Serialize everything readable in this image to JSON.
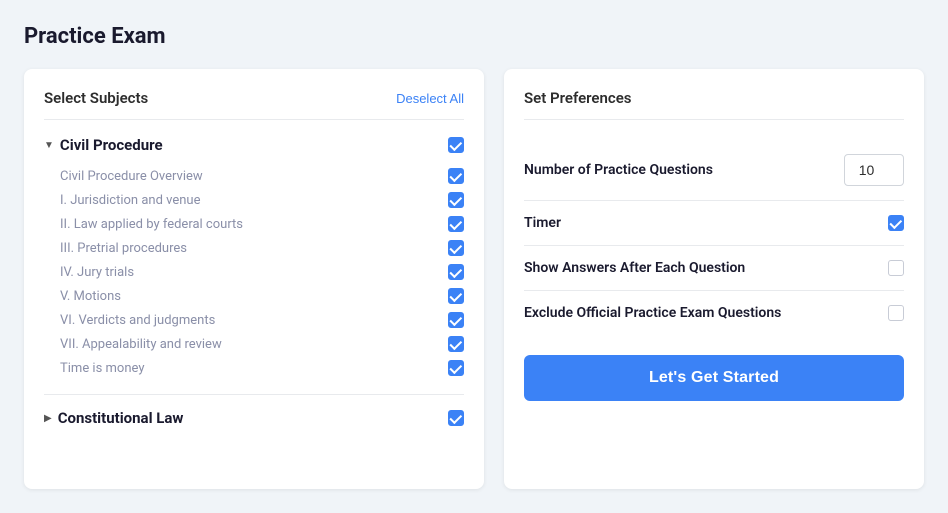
{
  "page": {
    "title": "Practice Exam"
  },
  "subjects_panel": {
    "title": "Select Subjects",
    "deselect_all": "Deselect All",
    "groups": [
      {
        "id": "civil-procedure",
        "name": "Civil Procedure",
        "expanded": true,
        "checked": true,
        "items": [
          {
            "label": "Civil Procedure Overview",
            "checked": true
          },
          {
            "label": "I. Jurisdiction and venue",
            "checked": true
          },
          {
            "label": "II. Law applied by federal courts",
            "checked": true
          },
          {
            "label": "III. Pretrial procedures",
            "checked": true
          },
          {
            "label": "IV. Jury trials",
            "checked": true
          },
          {
            "label": "V. Motions",
            "checked": true
          },
          {
            "label": "VI. Verdicts and judgments",
            "checked": true
          },
          {
            "label": "VII. Appealability and review",
            "checked": true
          },
          {
            "label": "Time is money",
            "checked": true
          }
        ]
      },
      {
        "id": "constitutional-law",
        "name": "Constitutional Law",
        "expanded": false,
        "checked": true,
        "items": []
      }
    ]
  },
  "preferences_panel": {
    "title": "Set Preferences",
    "rows": [
      {
        "id": "num-questions",
        "label": "Number of Practice Questions",
        "type": "input",
        "value": "10"
      },
      {
        "id": "timer",
        "label": "Timer",
        "type": "checkbox",
        "checked": true
      },
      {
        "id": "show-answers",
        "label": "Show Answers After Each Question",
        "type": "checkbox",
        "checked": false
      },
      {
        "id": "exclude-official",
        "label": "Exclude Official Practice Exam Questions",
        "type": "checkbox",
        "checked": false
      }
    ],
    "start_button": "Let's Get Started"
  }
}
